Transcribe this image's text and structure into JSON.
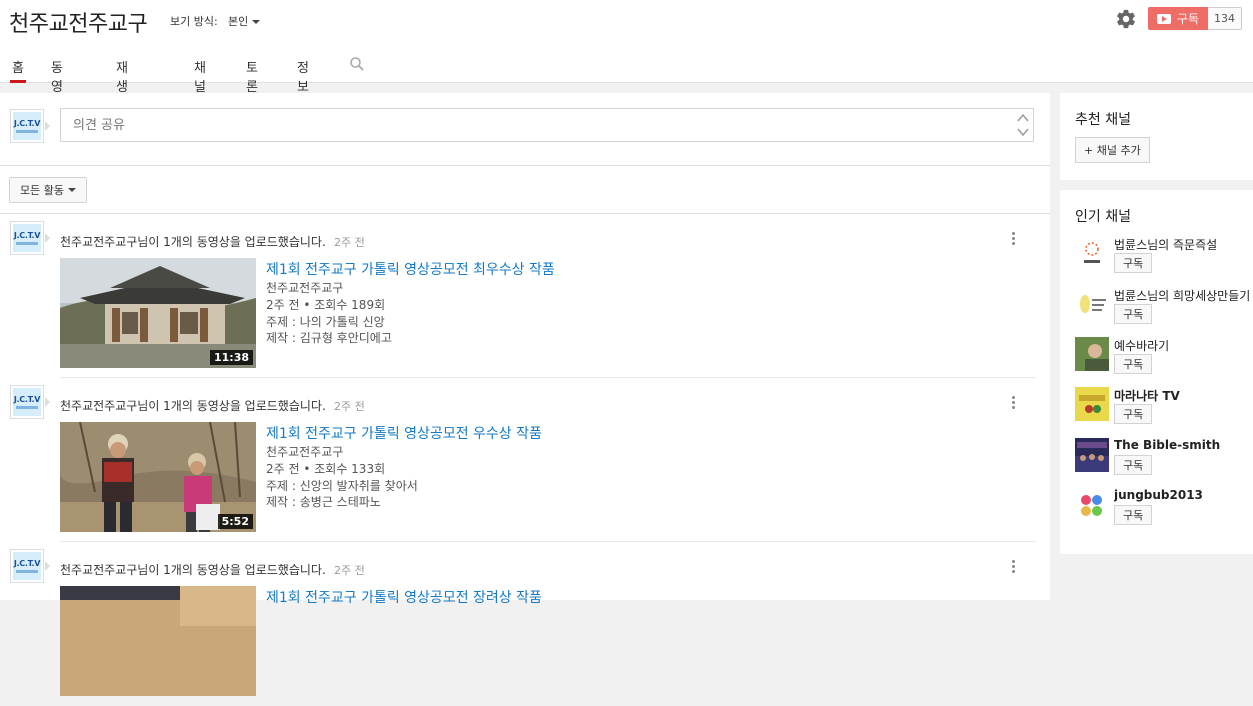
{
  "header": {
    "channel_title": "천주교전주교구",
    "view_as_label": "보기 방식:",
    "view_as_value": "본인",
    "subscribe_label": "구독",
    "subscriber_count": "134"
  },
  "tabs": [
    {
      "label": "홈",
      "active": true
    },
    {
      "label": "동영상"
    },
    {
      "label": "재생목록"
    },
    {
      "label": "채널"
    },
    {
      "label": "토론"
    },
    {
      "label": "정보"
    }
  ],
  "comment": {
    "placeholder": "의견 공유"
  },
  "avatar_text": "J.C.T.V",
  "filter": {
    "label": "모든 활동"
  },
  "feed": [
    {
      "action": "천주교전주교구님이 1개의 동영상을 업로드했습니다.",
      "time": "2주 전",
      "title": "제1회 전주교구 가톨릭 영상공모전 최우수상 작품",
      "channel": "천주교전주교구",
      "stats": "2주 전 • 조회수 189회",
      "theme": "주제 : 나의 가톨릭 신앙",
      "producer": "제작 : 김규형 후안디에고",
      "duration": "11:38"
    },
    {
      "action": "천주교전주교구님이 1개의 동영상을 업로드했습니다.",
      "time": "2주 전",
      "title": "제1회 전주교구 가톨릭 영상공모전 우수상 작품",
      "channel": "천주교전주교구",
      "stats": "2주 전 • 조회수 133회",
      "theme": "주제 : 신앙의 발자취를 찾아서",
      "producer": "제작 : 송병근 스테파노",
      "duration": "5:52"
    },
    {
      "action": "천주교전주교구님이 1개의 동영상을 업로드했습니다.",
      "time": "2주 전",
      "title": "제1회 전주교구 가톨릭 영상공모전 장려상 작품"
    }
  ],
  "sidebar": {
    "recommended_heading": "추천 채널",
    "add_channel_label": "+ 채널 추가",
    "popular_heading": "인기 채널",
    "subscribe_label": "구독",
    "popular": [
      {
        "name": "법륜스님의 즉문즉설",
        "bold": false
      },
      {
        "name": "법륜스님의 희망세상만들기",
        "bold": false
      },
      {
        "name": "예수바라기",
        "bold": false
      },
      {
        "name": "마라나타 TV",
        "bold": true
      },
      {
        "name": "The Bible-smith",
        "bold": true
      },
      {
        "name": "jungbub2013",
        "bold": true
      }
    ]
  },
  "colors": {
    "accent_red": "#cc181e",
    "link_blue": "#167ac6"
  }
}
